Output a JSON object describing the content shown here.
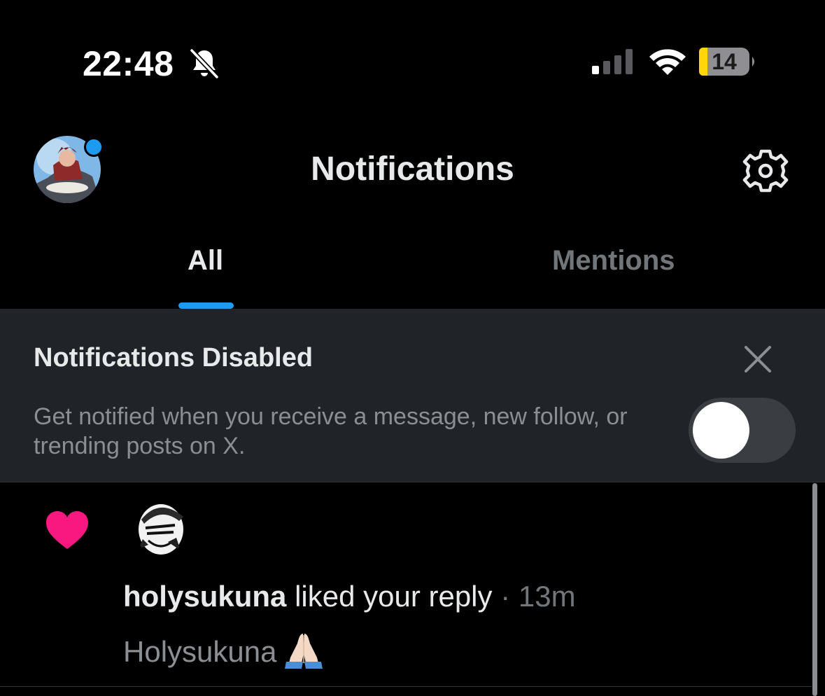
{
  "status_bar": {
    "time": "22:48",
    "silent_icon": "bell-slash-icon",
    "signal_icon": "cellular-signal-icon",
    "wifi_icon": "wifi-icon",
    "battery_level": "14",
    "battery_fraction": 0.14
  },
  "header": {
    "title": "Notifications",
    "avatar_icon": "profile-avatar",
    "settings_icon": "gear-icon",
    "accent_color": "#1d9bf0"
  },
  "tabs": [
    {
      "label": "All",
      "selected": true
    },
    {
      "label": "Mentions",
      "selected": false
    }
  ],
  "banner": {
    "title": "Notifications Disabled",
    "body": "Get notified when you receive a message, new follow, or trending posts on X.",
    "toggle_on": false,
    "close_icon": "close-icon"
  },
  "notifications": [
    {
      "type_icon": "heart-icon",
      "type_color": "#f91880",
      "user": "holysukuna",
      "action": "liked your reply",
      "separator": "·",
      "time": "13m",
      "text": "Holysukuna",
      "emoji": "🙏"
    }
  ]
}
